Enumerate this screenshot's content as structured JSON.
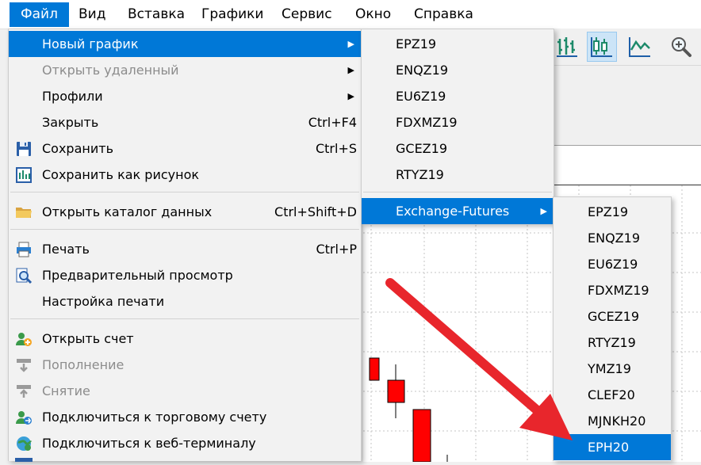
{
  "menubar": {
    "items": [
      "Файл",
      "Вид",
      "Вставка",
      "Графики",
      "Сервис",
      "Окно",
      "Справка"
    ],
    "active_index": 0
  },
  "file_menu": {
    "items": [
      {
        "label": "Новый график",
        "shortcut": "",
        "submenu": true,
        "selected": true,
        "disabled": false,
        "icon": ""
      },
      {
        "label": "Открыть удаленный",
        "shortcut": "",
        "submenu": true,
        "selected": false,
        "disabled": true,
        "icon": ""
      },
      {
        "label": "Профили",
        "shortcut": "",
        "submenu": true,
        "selected": false,
        "disabled": false,
        "icon": ""
      },
      {
        "label": "Закрыть",
        "shortcut": "Ctrl+F4",
        "submenu": false,
        "selected": false,
        "disabled": false,
        "icon": ""
      },
      {
        "label": "Сохранить",
        "shortcut": "Ctrl+S",
        "submenu": false,
        "selected": false,
        "disabled": false,
        "icon": "floppy-disk-icon"
      },
      {
        "label": "Сохранить как рисунок",
        "shortcut": "",
        "submenu": false,
        "selected": false,
        "disabled": false,
        "icon": "save-picture-icon"
      },
      {
        "label": "Открыть каталог данных",
        "shortcut": "Ctrl+Shift+D",
        "submenu": false,
        "selected": false,
        "disabled": false,
        "icon": "folder-icon"
      },
      {
        "label": "Печать",
        "shortcut": "Ctrl+P",
        "submenu": false,
        "selected": false,
        "disabled": false,
        "icon": "printer-icon"
      },
      {
        "label": "Предварительный просмотр",
        "shortcut": "",
        "submenu": false,
        "selected": false,
        "disabled": false,
        "icon": "print-preview-icon"
      },
      {
        "label": "Настройка печати",
        "shortcut": "",
        "submenu": false,
        "selected": false,
        "disabled": false,
        "icon": ""
      },
      {
        "label": "Открыть счет",
        "shortcut": "",
        "submenu": false,
        "selected": false,
        "disabled": false,
        "icon": "open-account-icon"
      },
      {
        "label": "Пополнение",
        "shortcut": "",
        "submenu": false,
        "selected": false,
        "disabled": true,
        "icon": "deposit-icon"
      },
      {
        "label": "Снятие",
        "shortcut": "",
        "submenu": false,
        "selected": false,
        "disabled": true,
        "icon": "withdraw-icon"
      },
      {
        "label": "Подключиться к торговому счету",
        "shortcut": "",
        "submenu": false,
        "selected": false,
        "disabled": false,
        "icon": "connect-account-icon"
      },
      {
        "label": "Подключиться к веб-терминалу",
        "shortcut": "",
        "submenu": false,
        "selected": false,
        "disabled": false,
        "icon": "web-terminal-icon"
      }
    ]
  },
  "submenu_new_chart": {
    "items": [
      "EPZ19",
      "ENQZ19",
      "EU6Z19",
      "FDXMZ19",
      "GCEZ19",
      "RTYZ19"
    ],
    "group_label": "Exchange-Futures",
    "group_selected": true
  },
  "submenu_exchange_futures": {
    "items": [
      "EPZ19",
      "ENQZ19",
      "EU6Z19",
      "FDXMZ19",
      "GCEZ19",
      "RTYZ19",
      "YMZ19",
      "CLEF20",
      "MJNKH20",
      "EPH20"
    ],
    "selected_index": 9
  },
  "toolbar": {
    "icons": [
      "bar-chart-icon",
      "candlestick-chart-icon",
      "line-chart-icon",
      "zoom-in-icon"
    ],
    "pressed_index": 1
  },
  "colors": {
    "accent": "#0078d7",
    "arrow": "#e8262c",
    "candle_bear": "#ff0000"
  }
}
